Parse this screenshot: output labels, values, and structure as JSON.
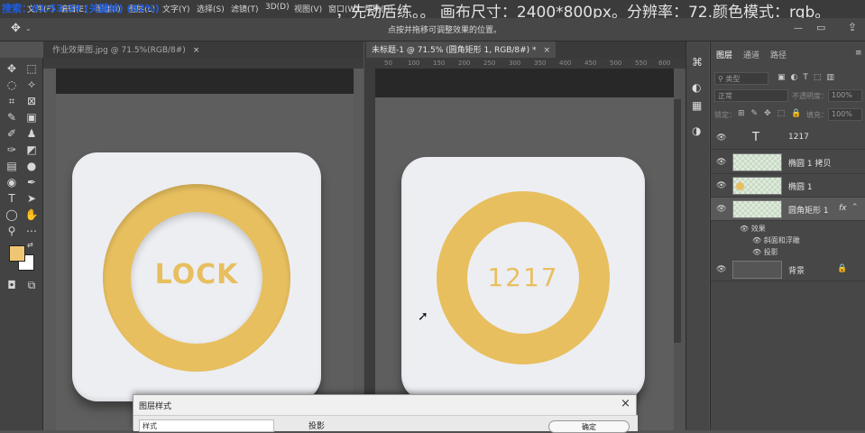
{
  "overlay": {
    "left": "搜索：01:53:39 (关键帧) (82%)",
    "right": "，先动后练。。  画布尺寸：2400*800px。分辨率：72.颜色模式：rgb。"
  },
  "menu": [
    "文件(F)",
    "编辑(E)",
    "图像(I)",
    "图层(L)",
    "文字(Y)",
    "选择(S)",
    "滤镜(T)",
    "3D(D)",
    "视图(V)",
    "窗口(W)",
    "帮助(H)"
  ],
  "options_bar": {
    "hint": "点按并拖移可调整效果的位置。"
  },
  "tabs": {
    "left": {
      "label": "作业效果图.jpg @ 71.5%(RGB/8#)",
      "close": "×"
    },
    "right": {
      "label": "未标题-1 @ 71.5% (圆角矩形 1, RGB/8#) *",
      "close": "×"
    }
  },
  "ruler_right": [
    "50",
    "100",
    "150",
    "200",
    "250",
    "300",
    "350",
    "400",
    "450",
    "500",
    "550",
    "600",
    "650"
  ],
  "ruler_left": [
    "0",
    "5",
    "0",
    "1",
    "0",
    "0",
    "1",
    "5",
    "0",
    "2",
    "0",
    "0",
    "2",
    "5",
    "0",
    "3"
  ],
  "canvas": {
    "left_card_text": "LOCK",
    "right_card_text": "1217",
    "ring_color": "#e8bf5f",
    "card_color": "#eceef2"
  },
  "panel": {
    "tabs": [
      "图层",
      "通道",
      "路径"
    ],
    "search_placeholder": "类型",
    "blend_mode": "正常",
    "opacity_label": "不透明度：",
    "opacity_value": "100%",
    "lock_label": "锁定：",
    "fill_label": "填充：",
    "fill_value": "100%",
    "layers": [
      {
        "name": "1217",
        "type": "text"
      },
      {
        "name": "椭圆 1 拷贝",
        "type": "shape"
      },
      {
        "name": "椭圆 1",
        "type": "shape"
      },
      {
        "name": "圆角矩形 1",
        "type": "shape",
        "fx": "fx"
      },
      {
        "name": "背景",
        "type": "background"
      }
    ],
    "effects_label": "效果",
    "effects": [
      "斜面和浮雕",
      "投影"
    ]
  },
  "dialog": {
    "title": "图层样式",
    "close": "×",
    "left_label": "样式",
    "section": "投影",
    "ok": "确定"
  },
  "colors": {
    "foreground": "#f0c674",
    "background": "#ffffff",
    "accent": "#e8bf5f"
  }
}
